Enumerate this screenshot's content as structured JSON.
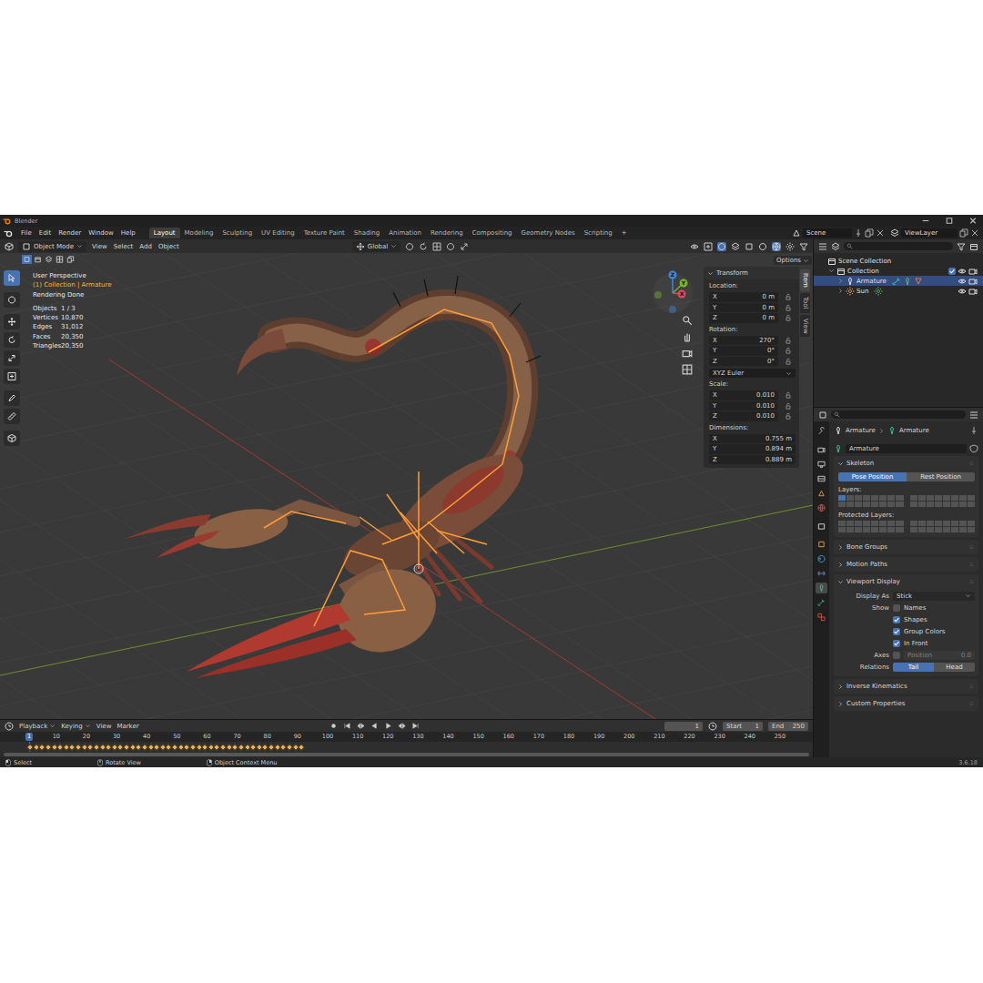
{
  "window": {
    "title": "Blender"
  },
  "top_bar": {
    "menus": [
      "File",
      "Edit",
      "Render",
      "Window",
      "Help"
    ],
    "workspaces": [
      {
        "label": "Layout",
        "selected": true
      },
      {
        "label": "Modeling",
        "selected": false
      },
      {
        "label": "Sculpting",
        "selected": false
      },
      {
        "label": "UV Editing",
        "selected": false
      },
      {
        "label": "Texture Paint",
        "selected": false
      },
      {
        "label": "Shading",
        "selected": false
      },
      {
        "label": "Animation",
        "selected": false
      },
      {
        "label": "Rendering",
        "selected": false
      },
      {
        "label": "Compositing",
        "selected": false
      },
      {
        "label": "Geometry Nodes",
        "selected": false
      },
      {
        "label": "Scripting",
        "selected": false
      }
    ],
    "add_workspace": "+",
    "scene": "Scene",
    "view_layer": "ViewLayer"
  },
  "viewport": {
    "header": {
      "mode": "Object Mode",
      "menus": [
        "View",
        "Select",
        "Add",
        "Object"
      ],
      "orientation": "Global",
      "options": "Options"
    },
    "overlay": {
      "view": "User Perspective",
      "context": "(1) Collection | Armature",
      "status": "Rendering Done",
      "stats": [
        {
          "label": "Objects",
          "value": "1 / 3"
        },
        {
          "label": "Vertices",
          "value": "10,870"
        },
        {
          "label": "Edges",
          "value": "31,012"
        },
        {
          "label": "Faces",
          "value": "20,350"
        },
        {
          "label": "Triangles",
          "value": "20,350"
        }
      ]
    },
    "gizmo": [
      {
        "label": "X",
        "color": "#e5475a"
      },
      {
        "label": "Y",
        "color": "#75b32e"
      },
      {
        "label": "Z",
        "color": "#3f86d9"
      }
    ],
    "sidebar": {
      "tabs": [
        {
          "label": "Item",
          "selected": true
        },
        {
          "label": "Tool",
          "selected": false
        },
        {
          "label": "View",
          "selected": false
        }
      ],
      "panel": {
        "title": "Transform",
        "expanded": true,
        "groups": [
          {
            "label": "Location:",
            "rows": [
              {
                "axis": "X",
                "value": "0 m"
              },
              {
                "axis": "Y",
                "value": "0 m"
              },
              {
                "axis": "Z",
                "value": "0 m"
              }
            ],
            "locks": true,
            "dropdown": null
          },
          {
            "label": "Rotation:",
            "rows": [
              {
                "axis": "X",
                "value": "270°"
              },
              {
                "axis": "Y",
                "value": "0°"
              },
              {
                "axis": "Z",
                "value": "0°"
              }
            ],
            "locks": true,
            "dropdown": "XYZ Euler"
          },
          {
            "label": "Scale:",
            "rows": [
              {
                "axis": "X",
                "value": "0.010"
              },
              {
                "axis": "Y",
                "value": "0.010"
              },
              {
                "axis": "Z",
                "value": "0.010"
              }
            ],
            "locks": true,
            "dropdown": null
          },
          {
            "label": "Dimensions:",
            "rows": [
              {
                "axis": "X",
                "value": "0.755 m"
              },
              {
                "axis": "Y",
                "value": "0.894 m"
              },
              {
                "axis": "Z",
                "value": "0.889 m"
              }
            ],
            "locks": false,
            "dropdown": null
          }
        ]
      }
    }
  },
  "timeline": {
    "menus": [
      {
        "label": "Playback",
        "dropdown": true
      },
      {
        "label": "Keying",
        "dropdown": true
      },
      {
        "label": "View",
        "dropdown": false
      },
      {
        "label": "Marker",
        "dropdown": false
      }
    ],
    "current_frame": "1",
    "start": {
      "label": "Start",
      "value": "1"
    },
    "end": {
      "label": "End",
      "value": "250"
    },
    "ruler": [
      {
        "label": "1",
        "selected": true
      },
      {
        "label": "10",
        "selected": false
      },
      {
        "label": "20",
        "selected": false
      },
      {
        "label": "30",
        "selected": false
      },
      {
        "label": "40",
        "selected": false
      },
      {
        "label": "50",
        "selected": false
      },
      {
        "label": "60",
        "selected": false
      },
      {
        "label": "70",
        "selected": false
      },
      {
        "label": "80",
        "selected": false
      },
      {
        "label": "90",
        "selected": false
      },
      {
        "label": "100",
        "selected": false
      },
      {
        "label": "110",
        "selected": false
      },
      {
        "label": "120",
        "selected": false
      },
      {
        "label": "130",
        "selected": false
      },
      {
        "label": "140",
        "selected": false
      },
      {
        "label": "150",
        "selected": false
      },
      {
        "label": "160",
        "selected": false
      },
      {
        "label": "170",
        "selected": false
      },
      {
        "label": "180",
        "selected": false
      },
      {
        "label": "190",
        "selected": false
      },
      {
        "label": "200",
        "selected": false
      },
      {
        "label": "210",
        "selected": false
      },
      {
        "label": "220",
        "selected": false
      },
      {
        "label": "230",
        "selected": false
      },
      {
        "label": "240",
        "selected": false
      },
      {
        "label": "250",
        "selected": false
      }
    ],
    "keyframes": [
      1,
      3,
      5,
      7,
      9,
      11,
      13,
      15,
      17,
      19,
      21,
      23,
      25,
      27,
      29,
      31,
      33,
      35,
      37,
      39,
      41,
      43,
      45,
      47,
      49,
      51,
      53,
      55,
      57,
      59,
      61,
      63,
      65,
      67,
      69,
      71,
      73,
      75,
      77,
      79,
      81,
      83,
      85,
      87,
      89,
      91
    ]
  },
  "outliner": {
    "items": [
      {
        "label": "Scene Collection",
        "depth": 0,
        "kind": "scene",
        "expanded": true,
        "selected": false
      },
      {
        "label": "Collection",
        "depth": 1,
        "kind": "collection",
        "expanded": true,
        "selected": false,
        "checked": true
      },
      {
        "label": "Armature",
        "depth": 2,
        "kind": "armature",
        "expanded": false,
        "selected": true
      },
      {
        "label": "Sun",
        "depth": 2,
        "kind": "light",
        "expanded": false,
        "selected": false
      }
    ]
  },
  "properties": {
    "tabs": [
      {
        "kind": "tool",
        "selected": false
      },
      {
        "kind": "render",
        "selected": false
      },
      {
        "kind": "output",
        "selected": false
      },
      {
        "kind": "view_layer",
        "selected": false
      },
      {
        "kind": "scene",
        "selected": false
      },
      {
        "kind": "world",
        "selected": false
      },
      {
        "kind": "collection",
        "selected": false
      },
      {
        "kind": "object",
        "selected": false
      },
      {
        "kind": "physics",
        "selected": false
      },
      {
        "kind": "constraints",
        "selected": false
      },
      {
        "kind": "data",
        "selected": true
      },
      {
        "kind": "bone",
        "selected": false
      },
      {
        "kind": "texture",
        "selected": false
      }
    ],
    "breadcrumb": [
      "Armature",
      "Armature"
    ],
    "name_field": "Armature",
    "sections": [
      {
        "kind": "skeleton",
        "title": "Skeleton",
        "expanded": true,
        "position": [
          {
            "label": "Pose Position",
            "selected": true
          },
          {
            "label": "Rest Position",
            "selected": false
          }
        ],
        "layers_label": "Layers:",
        "layers": [
          [
            true,
            false,
            false,
            false,
            false,
            false,
            false,
            false,
            false,
            false,
            false,
            false,
            false,
            false,
            false,
            false
          ],
          [
            false,
            false,
            false,
            false,
            false,
            false,
            false,
            false,
            false,
            false,
            false,
            false,
            false,
            false,
            false,
            false
          ]
        ],
        "protected_label": "Protected Layers:",
        "protected": [
          [
            false,
            false,
            false,
            false,
            false,
            false,
            false,
            false,
            false,
            false,
            false,
            false,
            false,
            false,
            false,
            false
          ],
          [
            false,
            false,
            false,
            false,
            false,
            false,
            false,
            false,
            false,
            false,
            false,
            false,
            false,
            false,
            false,
            false
          ]
        ]
      },
      {
        "kind": "collapsed",
        "title": "Bone Groups",
        "expanded": false
      },
      {
        "kind": "collapsed",
        "title": "Motion Paths",
        "expanded": false
      },
      {
        "kind": "viewport_display",
        "title": "Viewport Display",
        "expanded": true,
        "display_as": {
          "label": "Display As",
          "value": "Stick"
        },
        "show_label": "Show",
        "show": [
          {
            "label": "Names",
            "checked": false
          },
          {
            "label": "Shapes",
            "checked": true
          },
          {
            "label": "Group Colors",
            "checked": true
          },
          {
            "label": "In Front",
            "checked": true
          }
        ],
        "axes": {
          "label": "Axes",
          "checked": false,
          "position_label": "Position",
          "position_value": "0.0",
          "disabled": true
        },
        "relations": {
          "label": "Relations",
          "options": [
            {
              "label": "Tail",
              "selected": true
            },
            {
              "label": "Head",
              "selected": false
            }
          ]
        }
      },
      {
        "kind": "collapsed",
        "title": "Inverse Kinematics",
        "expanded": false
      },
      {
        "kind": "collapsed",
        "title": "Custom Properties",
        "expanded": false
      }
    ]
  },
  "status_bar": {
    "hints": [
      {
        "label": "Select",
        "kind": "left"
      },
      {
        "label": "Rotate View",
        "kind": "middle"
      },
      {
        "label": "Object Context Menu",
        "kind": "right"
      }
    ],
    "version": "3.6.18"
  }
}
